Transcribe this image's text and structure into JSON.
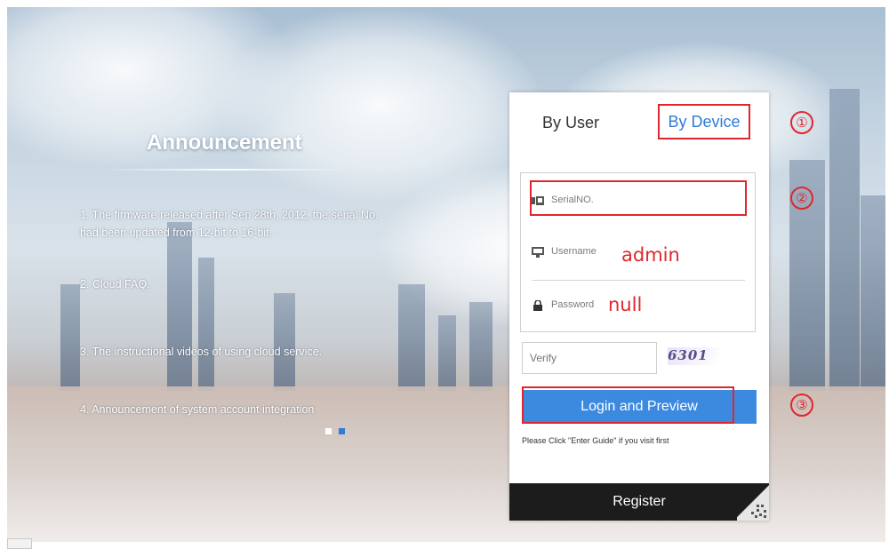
{
  "announcement": {
    "title": "Announcement",
    "items": [
      "1. The firmware released after Sep 28th, 2012, the serial No. had been updated from 12-bit to 16-bit.",
      "2. Cloud FAQ.",
      "3. The instructional videos of using cloud service.",
      "4. Announcement of system account integration"
    ],
    "pager": [
      "active",
      "inactive"
    ]
  },
  "login": {
    "tabs": {
      "user": "By User",
      "device": "By Device"
    },
    "serial_placeholder": "SerialNO.",
    "username_label": "Username",
    "username_value": "admin",
    "password_label": "Password",
    "password_value": "null",
    "verify_placeholder": "Verify",
    "captcha_text": "6301",
    "login_button": "Login and Preview",
    "hint": "Please Click \"Enter Guide\" if you visit first",
    "register_button": "Register"
  },
  "annotations": [
    "①",
    "②",
    "③"
  ],
  "colors": {
    "accent_blue": "#3b8ae0",
    "annotation_red": "#e0262c",
    "register_bg": "#1c1c1c"
  }
}
